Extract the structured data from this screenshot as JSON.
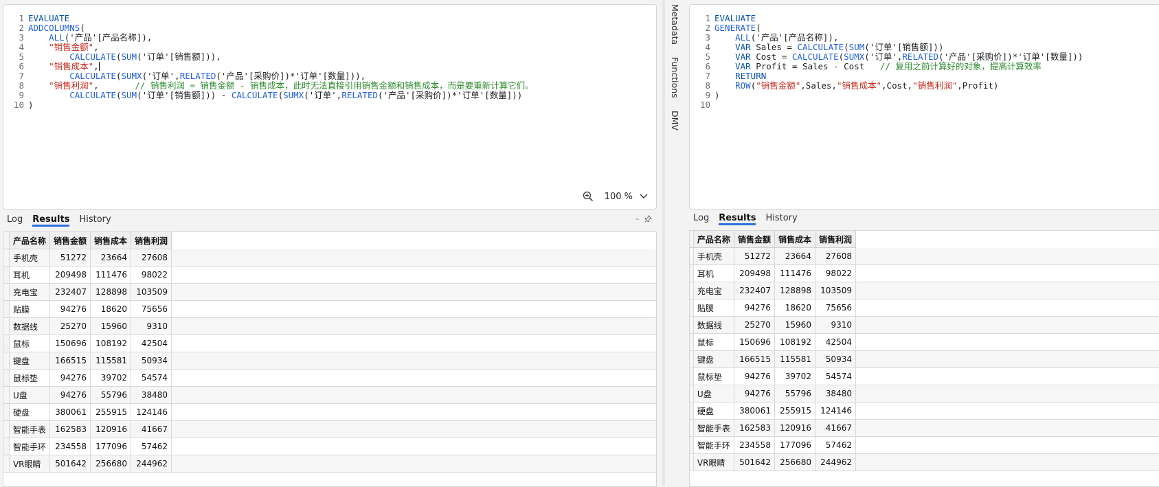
{
  "left_editor": {
    "lines": [
      {
        "n": "1",
        "parts": [
          {
            "t": "EVALUATE",
            "c": "kw"
          }
        ]
      },
      {
        "n": "2",
        "parts": [
          {
            "t": "ADDCOLUMNS",
            "c": "fn"
          },
          {
            "t": "(",
            "c": "tx"
          }
        ]
      },
      {
        "n": "3",
        "parts": [
          {
            "t": "    ",
            "c": "tx"
          },
          {
            "t": "ALL",
            "c": "fn"
          },
          {
            "t": "('产品'[产品名称]),",
            "c": "tx"
          }
        ]
      },
      {
        "n": "4",
        "parts": [
          {
            "t": "    ",
            "c": "tx"
          },
          {
            "t": "\"销售金额\"",
            "c": "str"
          },
          {
            "t": ",",
            "c": "tx"
          }
        ]
      },
      {
        "n": "5",
        "parts": [
          {
            "t": "        ",
            "c": "tx"
          },
          {
            "t": "CALCULATE",
            "c": "fn"
          },
          {
            "t": "(",
            "c": "tx"
          },
          {
            "t": "SUM",
            "c": "fn"
          },
          {
            "t": "('订单'[销售额])),",
            "c": "tx"
          }
        ]
      },
      {
        "n": "6",
        "parts": [
          {
            "t": "    ",
            "c": "tx"
          },
          {
            "t": "\"销售成本\"",
            "c": "str"
          },
          {
            "t": ",",
            "c": "tx"
          },
          {
            "t": "|",
            "c": "caret"
          }
        ]
      },
      {
        "n": "7",
        "parts": [
          {
            "t": "        ",
            "c": "tx"
          },
          {
            "t": "CALCULATE",
            "c": "fn"
          },
          {
            "t": "(",
            "c": "tx"
          },
          {
            "t": "SUMX",
            "c": "fn"
          },
          {
            "t": "('订单',",
            "c": "tx"
          },
          {
            "t": "RELATED",
            "c": "fn"
          },
          {
            "t": "('产品'[采购价])*'订单'[数量])),",
            "c": "tx"
          }
        ]
      },
      {
        "n": "8",
        "parts": [
          {
            "t": "    ",
            "c": "tx"
          },
          {
            "t": "\"销售利润\"",
            "c": "str"
          },
          {
            "t": ",       ",
            "c": "tx"
          },
          {
            "t": "// 销售利润 = 销售金额 - 销售成本，此时无法直接引用销售金额和销售成本，而是要重新计算它们。",
            "c": "cm"
          }
        ]
      },
      {
        "n": "9",
        "parts": [
          {
            "t": "        ",
            "c": "tx"
          },
          {
            "t": "CALCULATE",
            "c": "fn"
          },
          {
            "t": "(",
            "c": "tx"
          },
          {
            "t": "SUM",
            "c": "fn"
          },
          {
            "t": "('订单'[销售额])) - ",
            "c": "tx"
          },
          {
            "t": "CALCULATE",
            "c": "fn"
          },
          {
            "t": "(",
            "c": "tx"
          },
          {
            "t": "SUMX",
            "c": "fn"
          },
          {
            "t": "('订单',",
            "c": "tx"
          },
          {
            "t": "RELATED",
            "c": "fn"
          },
          {
            "t": "('产品'[采购价])*'订单'[数量]))",
            "c": "tx"
          }
        ]
      },
      {
        "n": "10",
        "parts": [
          {
            "t": ")",
            "c": "tx"
          }
        ]
      }
    ],
    "zoom": "100 %"
  },
  "right_editor": {
    "lines": [
      {
        "n": "1",
        "parts": [
          {
            "t": "EVALUATE",
            "c": "kw"
          }
        ]
      },
      {
        "n": "2",
        "parts": [
          {
            "t": "GENERATE",
            "c": "fn"
          },
          {
            "t": "(",
            "c": "tx"
          }
        ]
      },
      {
        "n": "3",
        "parts": [
          {
            "t": "    ",
            "c": "tx"
          },
          {
            "t": "ALL",
            "c": "fn"
          },
          {
            "t": "('产品'[产品名称]),",
            "c": "tx"
          }
        ]
      },
      {
        "n": "4",
        "parts": [
          {
            "t": "    ",
            "c": "tx"
          },
          {
            "t": "VAR",
            "c": "kw"
          },
          {
            "t": " Sales = ",
            "c": "tx"
          },
          {
            "t": "CALCULATE",
            "c": "fn"
          },
          {
            "t": "(",
            "c": "tx"
          },
          {
            "t": "SUM",
            "c": "fn"
          },
          {
            "t": "('订单'[销售额]))",
            "c": "tx"
          }
        ]
      },
      {
        "n": "5",
        "parts": [
          {
            "t": "    ",
            "c": "tx"
          },
          {
            "t": "VAR",
            "c": "kw"
          },
          {
            "t": " Cost = ",
            "c": "tx"
          },
          {
            "t": "CALCULATE",
            "c": "fn"
          },
          {
            "t": "(",
            "c": "tx"
          },
          {
            "t": "SUMX",
            "c": "fn"
          },
          {
            "t": "('订单',",
            "c": "tx"
          },
          {
            "t": "RELATED",
            "c": "fn"
          },
          {
            "t": "('产品'[采购价])*'订单'[数量]))",
            "c": "tx"
          }
        ]
      },
      {
        "n": "6",
        "parts": [
          {
            "t": "    ",
            "c": "tx"
          },
          {
            "t": "VAR",
            "c": "kw"
          },
          {
            "t": " Profit = Sales - Cost   ",
            "c": "tx"
          },
          {
            "t": "// 复用之前计算好的对象，提高计算效率",
            "c": "cm"
          }
        ]
      },
      {
        "n": "7",
        "parts": [
          {
            "t": "    ",
            "c": "tx"
          },
          {
            "t": "RETURN",
            "c": "kw"
          }
        ]
      },
      {
        "n": "8",
        "parts": [
          {
            "t": "    ",
            "c": "tx"
          },
          {
            "t": "ROW",
            "c": "fn"
          },
          {
            "t": "(",
            "c": "tx"
          },
          {
            "t": "\"销售金额\"",
            "c": "str"
          },
          {
            "t": ",Sales,",
            "c": "tx"
          },
          {
            "t": "\"销售成本\"",
            "c": "str"
          },
          {
            "t": ",Cost,",
            "c": "tx"
          },
          {
            "t": "\"销售利润\"",
            "c": "str"
          },
          {
            "t": ",Profit)",
            "c": "tx"
          }
        ]
      },
      {
        "n": "9",
        "parts": [
          {
            "t": ")",
            "c": "tx"
          }
        ]
      },
      {
        "n": "10",
        "parts": []
      }
    ]
  },
  "side_tabs": [
    "Metadata",
    "Functions",
    "DMV"
  ],
  "result_tabs": [
    "Log",
    "Results",
    "History"
  ],
  "active_result_tab": "Results",
  "pane_buttons": {
    "collapse": "–",
    "pin": "📌"
  },
  "results": {
    "columns": [
      "产品名称",
      "销售金额",
      "销售成本",
      "销售利润"
    ],
    "rows": [
      [
        "手机壳",
        "51272",
        "23664",
        "27608"
      ],
      [
        "耳机",
        "209498",
        "111476",
        "98022"
      ],
      [
        "充电宝",
        "232407",
        "128898",
        "103509"
      ],
      [
        "贴膜",
        "94276",
        "18620",
        "75656"
      ],
      [
        "数据线",
        "25270",
        "15960",
        "9310"
      ],
      [
        "鼠标",
        "150696",
        "108192",
        "42504"
      ],
      [
        "键盘",
        "166515",
        "115581",
        "50934"
      ],
      [
        "鼠标垫",
        "94276",
        "39702",
        "54574"
      ],
      [
        "U盘",
        "94276",
        "55796",
        "38480"
      ],
      [
        "硬盘",
        "380061",
        "255915",
        "124146"
      ],
      [
        "智能手表",
        "162583",
        "120916",
        "41667"
      ],
      [
        "智能手环",
        "234558",
        "177096",
        "57462"
      ],
      [
        "VR眼睛",
        "501642",
        "256680",
        "244962"
      ]
    ]
  },
  "colors": {
    "accent": "#2b6fdc",
    "keyword": "#0451a5",
    "string": "#c42b1c",
    "comment": "#2e8b2e"
  }
}
